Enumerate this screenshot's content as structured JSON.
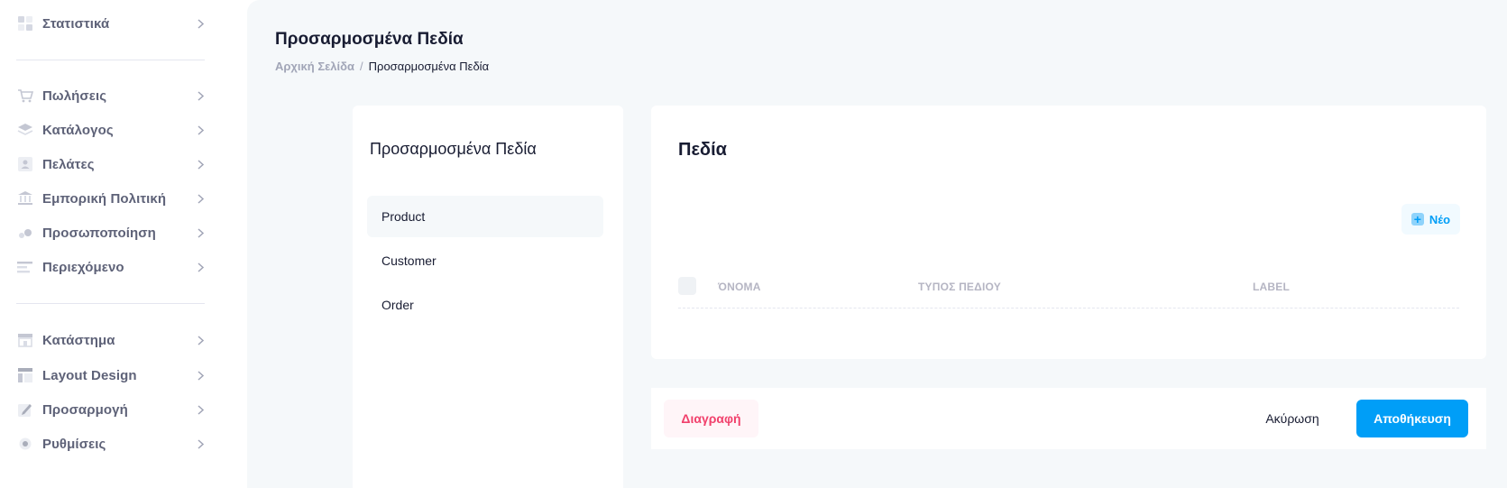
{
  "sidebar": {
    "items": [
      {
        "label": "Στατιστικά",
        "icon": "dashboard-icon"
      },
      {
        "label": "Πωλήσεις",
        "icon": "cart-icon"
      },
      {
        "label": "Κατάλογος",
        "icon": "layers-icon"
      },
      {
        "label": "Πελάτες",
        "icon": "users-icon"
      },
      {
        "label": "Εμπορική Πολιτική",
        "icon": "bank-icon"
      },
      {
        "label": "Προσωποποίηση",
        "icon": "personalize-icon"
      },
      {
        "label": "Περιεχόμενο",
        "icon": "content-icon"
      },
      {
        "label": "Κατάστημα",
        "icon": "store-icon"
      },
      {
        "label": "Layout Design",
        "icon": "layout-icon"
      },
      {
        "label": "Προσαρμογή",
        "icon": "edit-icon"
      },
      {
        "label": "Ρυθμίσεις",
        "icon": "gear-icon"
      }
    ]
  },
  "header": {
    "title": "Προσαρμοσμένα Πεδία",
    "breadcrumb": {
      "home": "Αρχική Σελίδα",
      "separator": "/",
      "current": "Προσαρμοσμένα Πεδία"
    }
  },
  "left_card": {
    "title": "Προσαρμοσμένα Πεδία",
    "items": [
      {
        "label": "Product",
        "active": true
      },
      {
        "label": "Customer",
        "active": false
      },
      {
        "label": "Order",
        "active": false
      }
    ]
  },
  "fields_card": {
    "title": "Πεδία",
    "new_button": "Νέο",
    "columns": [
      "ΌΝΟΜΑ",
      "ΤΥΠΟΣ ΠΕΔΙΟΥ",
      "LABEL"
    ],
    "rows": []
  },
  "footer": {
    "delete_label": "Διαγραφή",
    "cancel_label": "Ακύρωση",
    "save_label": "Αποθήκευση"
  },
  "colors": {
    "primary": "#009ef7",
    "danger": "#f1416c",
    "background": "#f5f8fa"
  }
}
